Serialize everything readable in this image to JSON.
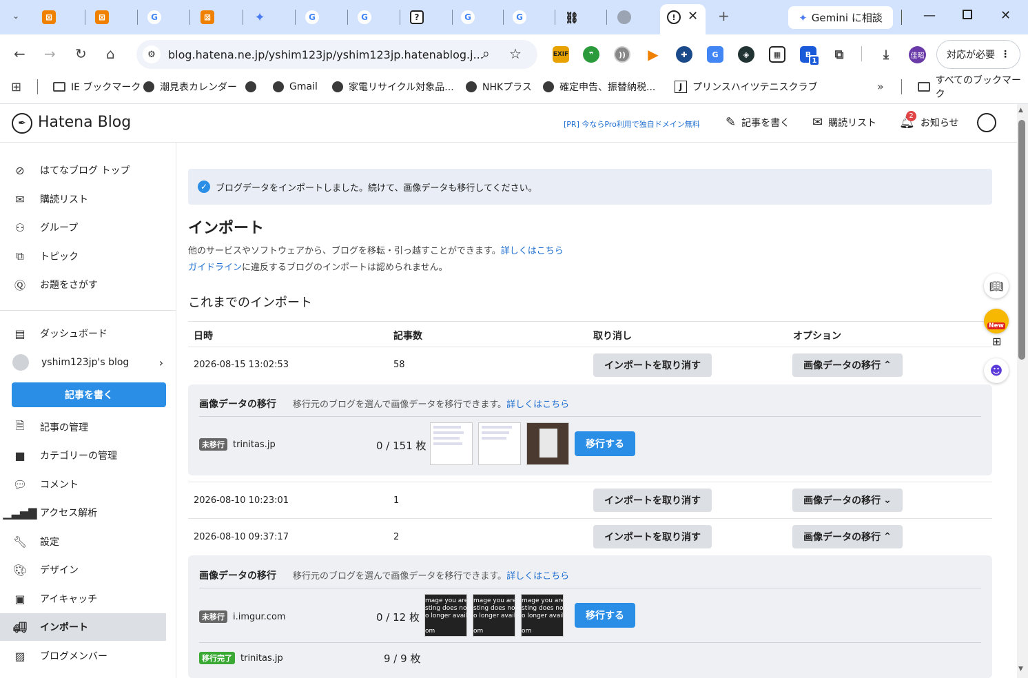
{
  "browser": {
    "gemini_label": "Gemini に相談",
    "url": "blog.hatena.ne.jp/yshim123jp/yshim123jp.hatenablog.j...",
    "profile_label": "対応が必要",
    "avatar_text": "佳昭",
    "ext_badge": "1",
    "exif_label": "EXIF"
  },
  "bookmarks": {
    "items": [
      "IE ブックマーク",
      "潮見表カレンダー",
      "Gmail",
      "家電リサイクル対象品...",
      "NHKプラス",
      "確定申告、振替納税...",
      "プリンスハイツテニスクラブ"
    ],
    "all_label": "すべてのブックマーク",
    "more": "»"
  },
  "header": {
    "logo": "Hatena Blog",
    "pr_link": "[PR] 今ならPro利用で独自ドメイン無料",
    "write": "記事を書く",
    "reading_list": "購読リスト",
    "notifications": "お知らせ",
    "notif_count": "2"
  },
  "sidebar": {
    "top_items": [
      "はてなブログ トップ",
      "購読リスト",
      "グループ",
      "トピック",
      "お題をさがす"
    ],
    "dashboard": "ダッシュボード",
    "blog_name": "yshim123jp's blog",
    "write_button": "記事を書く",
    "manage_items": [
      "記事の管理",
      "カテゴリーの管理",
      "コメント",
      "アクセス解析",
      "設定",
      "デザイン",
      "アイキャッチ",
      "インポート",
      "ブログメンバー"
    ]
  },
  "notice": "ブログデータをインポートしました。続けて、画像データも移行してください。",
  "main": {
    "title": "インポート",
    "desc1": "他のサービスやソフトウェアから、ブログを移転・引っ越すことができます。",
    "desc1_link": "詳しくはこちら",
    "desc2_link": "ガイドライン",
    "desc2": "に違反するブログのインポートは認められません。",
    "history_title": "これまでのインポート",
    "columns": [
      "日時",
      "記事数",
      "取り消し",
      "オプション"
    ],
    "cancel_label": "インポートを取り消す",
    "option_label": "画像データの移行",
    "rows": [
      {
        "date": "2026-08-15 13:02:53",
        "count": "58",
        "expanded": true
      },
      {
        "date": "2026-08-10 10:23:01",
        "count": "1",
        "expanded": false
      },
      {
        "date": "2026-08-10 09:37:17",
        "count": "2",
        "expanded": true
      }
    ],
    "panel_title": "画像データの移行",
    "panel_desc": "移行元のブログを選んで画像データを移行できます。",
    "panel_link": "詳しくはこちら",
    "migrate_btn": "移行する",
    "status_pending": "未移行",
    "status_done": "移行完了",
    "panel1": {
      "source": "trinitas.jp",
      "progress": "0 / 151 枚"
    },
    "panel2": {
      "source": "i.imgur.com",
      "progress": "0 / 12 枚",
      "done_source": "trinitas.jp",
      "done_progress": "9 / 9 枚"
    },
    "imgur_text": "mage you are\nsting does no\no longer avail\n\nom"
  },
  "colors": {
    "accent": "#2b8ee6",
    "tab_strip": "#d3e3fd",
    "pending": "#666666",
    "done": "#3aaa35"
  }
}
